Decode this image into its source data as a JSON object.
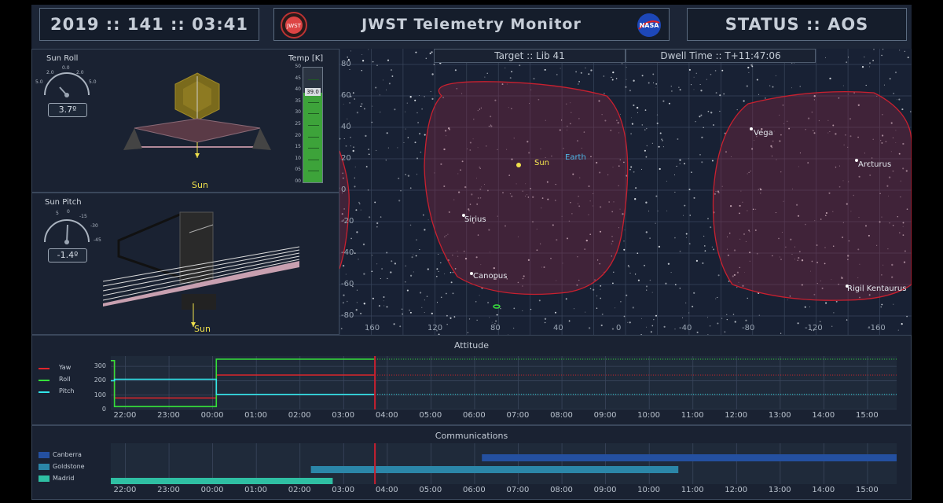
{
  "header": {
    "clock": "2019 :: 141 :: 03:41",
    "title": "JWST Telemetry Monitor",
    "status": "STATUS :: AOS",
    "logo_left_text": "JWST",
    "logo_right_text": "NASA"
  },
  "sun_roll": {
    "title": "Sun Roll",
    "value": "3.7º",
    "ticks": [
      "5.0",
      "2.0",
      "0.0",
      "2.0",
      "5.0"
    ],
    "sun_label": "Sun"
  },
  "sun_pitch": {
    "title": "Sun Pitch",
    "value": "-1.4º",
    "ticks": [
      "5",
      "0",
      "-15",
      "-30",
      "-45"
    ],
    "sun_label": "Sun"
  },
  "temperature": {
    "title": "Temp [K]",
    "value": "39.0",
    "level_fraction": 0.78,
    "scale": [
      "50",
      "45",
      "40",
      "35",
      "30",
      "25",
      "20",
      "15",
      "10",
      "05",
      "00"
    ]
  },
  "sky_map": {
    "target": "Target :: Lib 41",
    "dwell": "Dwell Time :: T+11:47:06",
    "y_ticks": [
      "80",
      "60",
      "40",
      "20",
      "0",
      "-20",
      "-40",
      "-60",
      "-80"
    ],
    "x_ticks": [
      "160",
      "120",
      "80",
      "40",
      "0",
      "-40",
      "-80",
      "-120",
      "-160"
    ],
    "objects": [
      {
        "name": "Sun",
        "color": "#f0e14c"
      },
      {
        "name": "Earth",
        "color": "#4fb6e6"
      },
      {
        "name": "Sirius",
        "color": "#e6e9ee"
      },
      {
        "name": "Canopus",
        "color": "#e6e9ee"
      },
      {
        "name": "Vega",
        "color": "#e6e9ee"
      },
      {
        "name": "Arcturus",
        "color": "#e6e9ee"
      },
      {
        "name": "Rigil Kentaurus",
        "color": "#e6e9ee"
      }
    ]
  },
  "attitude": {
    "title": "Attitude",
    "legend": [
      {
        "name": "Yaw",
        "color": "#e0262b"
      },
      {
        "name": "Roll",
        "color": "#35e03a"
      },
      {
        "name": "Pitch",
        "color": "#32e6ea"
      }
    ],
    "y_ticks": [
      "300",
      "200",
      "100",
      "0"
    ],
    "x_ticks": [
      "22:00",
      "23:00",
      "00:00",
      "01:00",
      "02:00",
      "03:00",
      "04:00",
      "05:00",
      "06:00",
      "07:00",
      "08:00",
      "09:00",
      "10:00",
      "11:00",
      "12:00",
      "13:00",
      "14:00",
      "15:00"
    ]
  },
  "communications": {
    "title": "Communications",
    "legend": [
      {
        "name": "Canberra",
        "color": "#2450a0"
      },
      {
        "name": "Goldstone",
        "color": "#2b86a8"
      },
      {
        "name": "Madrid",
        "color": "#2fbfa3"
      }
    ],
    "x_ticks": [
      "22:00",
      "23:00",
      "00:00",
      "01:00",
      "02:00",
      "03:00",
      "04:00",
      "05:00",
      "06:00",
      "07:00",
      "08:00",
      "09:00",
      "10:00",
      "11:00",
      "12:00",
      "13:00",
      "14:00",
      "15:00"
    ]
  },
  "chart_data": [
    {
      "type": "line",
      "title": "Attitude",
      "x_range": [
        "21:40",
        "15:40"
      ],
      "current_time": "03:43",
      "ylim": [
        0,
        350
      ],
      "series": [
        {
          "name": "Yaw",
          "points": [
            [
              "21:40",
              340
            ],
            [
              "21:45",
              80
            ],
            [
              "00:00",
              80
            ],
            [
              "00:05",
              240
            ],
            [
              "03:43",
              240
            ]
          ]
        },
        {
          "name": "Roll",
          "points": [
            [
              "21:40",
              340
            ],
            [
              "21:45",
              20
            ],
            [
              "00:00",
              20
            ],
            [
              "00:05",
              350
            ],
            [
              "03:43",
              350
            ]
          ]
        },
        {
          "name": "Pitch",
          "points": [
            [
              "21:40",
              200
            ],
            [
              "21:45",
              210
            ],
            [
              "00:00",
              210
            ],
            [
              "00:05",
              105
            ],
            [
              "03:43",
              105
            ]
          ]
        }
      ],
      "projection": [
        {
          "name": "Yaw",
          "value": 240
        },
        {
          "name": "Roll",
          "value": 350
        },
        {
          "name": "Pitch",
          "value": 105
        }
      ]
    },
    {
      "type": "bar",
      "title": "Communications",
      "x_range": [
        "21:40",
        "15:40"
      ],
      "current_time": "03:43",
      "series": [
        {
          "name": "Canberra",
          "start": "06:10",
          "end": "15:40"
        },
        {
          "name": "Goldstone",
          "start": "02:15",
          "end": "10:40"
        },
        {
          "name": "Madrid",
          "start": "21:40",
          "end": "02:45"
        }
      ]
    }
  ]
}
